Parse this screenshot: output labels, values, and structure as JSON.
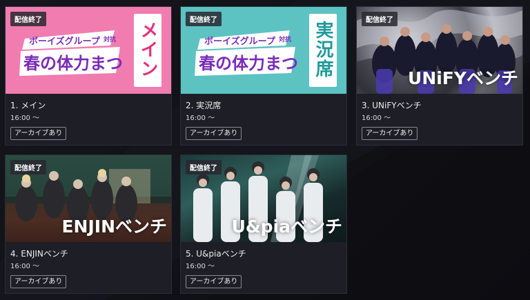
{
  "cards": [
    {
      "badge": "配信終了",
      "title": "1. メイン",
      "time": "16:00 〜",
      "archive": "アーカイブあり",
      "side_label": "メイン",
      "logo_line1": "ボーイズグループ",
      "logo_small": "対抗",
      "logo_line2": "春の体力まつり",
      "bg_color": "#f07cb0",
      "label_color": "#e2307e"
    },
    {
      "badge": "配信終了",
      "title": "2. 実況席",
      "time": "16:00 〜",
      "archive": "アーカイブあり",
      "side_label": "実況席",
      "logo_line1": "ボーイズグループ",
      "logo_small": "対抗",
      "logo_line2": "春の体力まつり",
      "bg_color": "#5cc2c2",
      "label_color": "#1e9a9a"
    },
    {
      "badge": "配信終了",
      "title": "3. UNiFYベンチ",
      "time": "16:00 〜",
      "archive": "アーカイブあり",
      "overlay": "UNiFYベンチ"
    },
    {
      "badge": "配信終了",
      "title": "4. ENJINベンチ",
      "time": "16:00 〜",
      "archive": "アーカイブあり",
      "overlay": "ENJINベンチ"
    },
    {
      "badge": "配信終了",
      "title": "5. U&piaベンチ",
      "time": "16:00 〜",
      "archive": "アーカイブあり",
      "overlay": "U&piaベンチ"
    }
  ]
}
